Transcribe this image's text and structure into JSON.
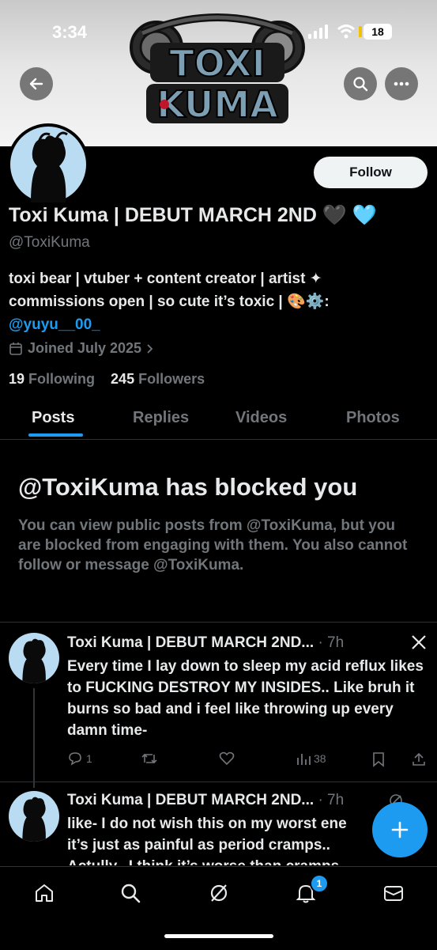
{
  "status_bar": {
    "time": "3:34",
    "battery": "18"
  },
  "header": {
    "logo_text_top": "TOXI",
    "logo_text_bottom": "KUMA"
  },
  "profile": {
    "name": "Toxi Kuma | DEBUT MARCH 2ND 🖤 🩵",
    "handle": "@ToxiKuma",
    "bio_line1": "toxi bear | vtuber + content creator | artist ✦",
    "bio_line2": "commissions open | so cute it’s toxic | 🎨⚙️:",
    "bio_mention": "@yuyu__00_",
    "joined": "Joined July 2025",
    "following_count": "19",
    "following_label": "Following",
    "followers_count": "245",
    "followers_label": "Followers",
    "follow_button": "Follow"
  },
  "tabs": [
    "Posts",
    "Replies",
    "Videos",
    "Photos"
  ],
  "blocked": {
    "title": "@ToxiKuma has blocked you",
    "message": "You can view public posts from @ToxiKuma, but you are blocked from engaging with them. You also cannot follow or message @ToxiKuma."
  },
  "posts": [
    {
      "author": "Toxi Kuma | DEBUT MARCH 2ND...",
      "time": "· 7h",
      "text": "Every time I lay down to sleep my acid reflux likes to FUCKING DESTROY MY INSIDES.. Like bruh it burns so bad and i feel like throwing up every damn time-",
      "replies": "1",
      "reposts": "",
      "likes": "",
      "views": "38"
    },
    {
      "author": "Toxi Kuma | DEBUT MARCH 2ND...",
      "time": "· 7h",
      "text_line1": "like- I do not wish this on my worst ene",
      "text_line2": "it’s just as painful as period cramps..",
      "text_line3": "Actully.. I think it’s worse than cramps"
    }
  ],
  "notifications_badge": "1",
  "colors": {
    "accent": "#1d9bf0",
    "background": "#000000",
    "muted": "#71767b"
  }
}
